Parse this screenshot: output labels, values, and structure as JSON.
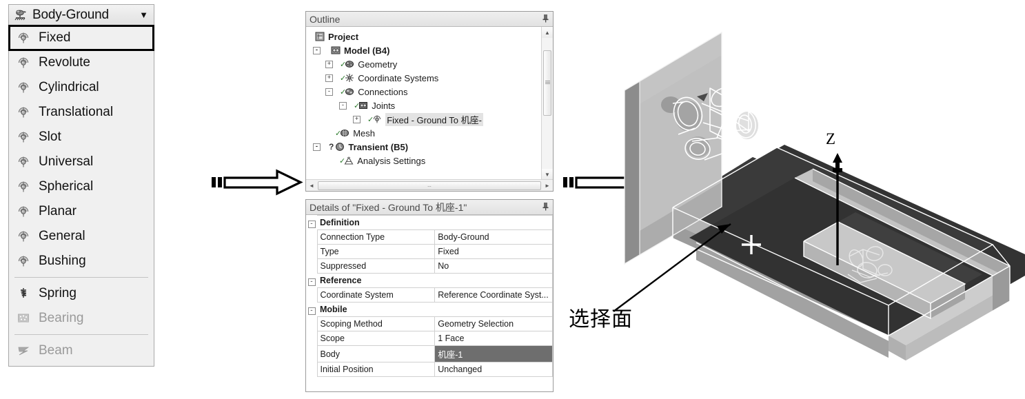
{
  "menu": {
    "button": {
      "label": "Body-Ground",
      "icon": "body-ground-icon",
      "caret": "▼"
    },
    "groups": [
      {
        "items": [
          {
            "label": "Fixed",
            "icon": "joint-icon",
            "selected": true,
            "disabled": false
          },
          {
            "label": "Revolute",
            "icon": "joint-icon",
            "selected": false,
            "disabled": false
          },
          {
            "label": "Cylindrical",
            "icon": "joint-icon",
            "selected": false,
            "disabled": false
          },
          {
            "label": "Translational",
            "icon": "joint-icon",
            "selected": false,
            "disabled": false
          },
          {
            "label": "Slot",
            "icon": "joint-icon",
            "selected": false,
            "disabled": false
          },
          {
            "label": "Universal",
            "icon": "joint-icon",
            "selected": false,
            "disabled": false
          },
          {
            "label": "Spherical",
            "icon": "joint-icon",
            "selected": false,
            "disabled": false
          },
          {
            "label": "Planar",
            "icon": "joint-icon",
            "selected": false,
            "disabled": false
          },
          {
            "label": "General",
            "icon": "joint-icon",
            "selected": false,
            "disabled": false
          },
          {
            "label": "Bushing",
            "icon": "joint-icon",
            "selected": false,
            "disabled": false
          }
        ]
      },
      {
        "items": [
          {
            "label": "Spring",
            "icon": "spring-icon",
            "selected": false,
            "disabled": false
          },
          {
            "label": "Bearing",
            "icon": "bearing-icon",
            "selected": false,
            "disabled": true
          }
        ]
      },
      {
        "items": [
          {
            "label": "Beam",
            "icon": "beam-icon",
            "selected": false,
            "disabled": true
          }
        ]
      }
    ]
  },
  "outline": {
    "title": "Outline",
    "pin_icon": "pin-icon",
    "tree": [
      {
        "label": "Project",
        "depth": 0,
        "expander": "",
        "bold": true,
        "icon": "project-icon",
        "check": false,
        "highlight": false
      },
      {
        "label": "Model (B4)",
        "depth": 1,
        "expander": "-",
        "bold": true,
        "icon": "model-icon",
        "check": false,
        "highlight": false
      },
      {
        "label": "Geometry",
        "depth": 2,
        "expander": "+",
        "bold": false,
        "icon": "geometry-icon",
        "check": true,
        "highlight": false
      },
      {
        "label": "Coordinate Systems",
        "depth": 2,
        "expander": "+",
        "bold": false,
        "icon": "coordsys-icon",
        "check": true,
        "highlight": false
      },
      {
        "label": "Connections",
        "depth": 2,
        "expander": "-",
        "bold": false,
        "icon": "connections-icon",
        "check": true,
        "highlight": false
      },
      {
        "label": "Joints",
        "depth": 3,
        "expander": "-",
        "bold": false,
        "icon": "joints-icon",
        "check": true,
        "highlight": false
      },
      {
        "label": "Fixed - Ground To 机座-",
        "depth": 4,
        "expander": "+",
        "bold": false,
        "icon": "joint-icon",
        "check": true,
        "highlight": true
      },
      {
        "label": "Mesh",
        "depth": 2,
        "expander": "",
        "bold": false,
        "icon": "mesh-icon",
        "check": true,
        "highlight": false
      },
      {
        "label": "Transient (B5)",
        "depth": 1,
        "expander": "-",
        "bold": true,
        "icon": "transient-icon",
        "check": false,
        "highlight": false
      },
      {
        "label": "Analysis Settings",
        "depth": 3,
        "expander": "",
        "bold": false,
        "icon": "analysis-icon",
        "check": true,
        "highlight": false
      }
    ],
    "scrollbar": {
      "up": "▲",
      "down": "▼",
      "left": "◄",
      "right": "►",
      "hthumb_grip": "…"
    }
  },
  "details": {
    "title": "Details of \"Fixed - Ground To 机座-1\"",
    "pin_icon": "pin-icon",
    "rows": [
      {
        "kind": "group",
        "key": "Definition",
        "value": "",
        "collapse": "-",
        "selected": false
      },
      {
        "kind": "row",
        "key": "Connection Type",
        "value": "Body-Ground",
        "collapse": "",
        "selected": false
      },
      {
        "kind": "row",
        "key": "Type",
        "value": "Fixed",
        "collapse": "",
        "selected": false
      },
      {
        "kind": "row",
        "key": "Suppressed",
        "value": "No",
        "collapse": "",
        "selected": false
      },
      {
        "kind": "group",
        "key": "Reference",
        "value": "",
        "collapse": "-",
        "selected": false
      },
      {
        "kind": "row",
        "key": "Coordinate System",
        "value": "Reference Coordinate Syst...",
        "collapse": "",
        "selected": false
      },
      {
        "kind": "group",
        "key": "Mobile",
        "value": "",
        "collapse": "-",
        "selected": false
      },
      {
        "kind": "row",
        "key": "Scoping Method",
        "value": "Geometry Selection",
        "collapse": "",
        "selected": false
      },
      {
        "kind": "row",
        "key": "Scope",
        "value": "1 Face",
        "collapse": "",
        "selected": false
      },
      {
        "kind": "row",
        "key": "Body",
        "value": "机座-1",
        "collapse": "",
        "selected": true
      },
      {
        "kind": "row",
        "key": "Initial Position",
        "value": "Unchanged",
        "collapse": "",
        "selected": false
      }
    ]
  },
  "flow": {
    "arrow1_name": "flow-arrow-right-1",
    "arrow2_name": "flow-arrow-right-2"
  },
  "viewport": {
    "z_axis_label": "Z",
    "annotation": "选择面",
    "crosshair": "+",
    "colors": {
      "selected_face": "#3b3b3b",
      "body_light": "#c9c9c9",
      "body_mid": "#a8a8a8",
      "body_dark": "#8e8e8e",
      "wireframe": "#ffffff",
      "outline": "#ffffff",
      "axis": "#000000"
    }
  }
}
